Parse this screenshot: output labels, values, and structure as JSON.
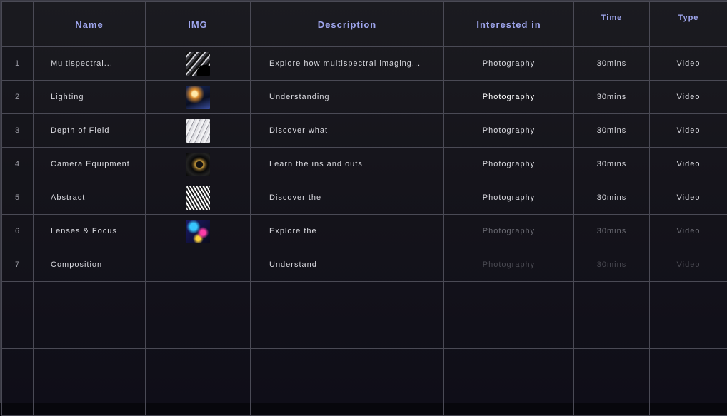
{
  "headers": {
    "name": "Name",
    "img": "IMG",
    "description": "Description",
    "interested": "Interested in",
    "time": "Time",
    "type": "Type"
  },
  "rows": [
    {
      "num": "1",
      "name": "Multispectral...",
      "image": "curved-metal-thumbnail",
      "description": "Explore how multispectral imaging...",
      "interested": "Photography",
      "time": "30mins",
      "type": "Video"
    },
    {
      "num": "2",
      "name": "Lighting",
      "image": "studio-light-thumbnail",
      "description": "Understanding",
      "interested": "Photography",
      "time": "30mins",
      "type": "Video"
    },
    {
      "num": "3",
      "name": "Depth of Field",
      "image": "white-waves-thumbnail",
      "description": "Discover what",
      "interested": "Photography",
      "time": "30mins",
      "type": "Video"
    },
    {
      "num": "4",
      "name": "Camera Equipment",
      "image": "camera-lens-thumbnail",
      "description": "Learn the ins and outs",
      "interested": "Photography",
      "time": "30mins",
      "type": "Video"
    },
    {
      "num": "5",
      "name": "Abstract",
      "image": "abstract-spiral-thumbnail",
      "description": "Discover the",
      "interested": "Photography",
      "time": "30mins",
      "type": "Video"
    },
    {
      "num": "6",
      "name": "Lenses & Focus",
      "image": "colorful-abstract-thumbnail",
      "description": "Explore the",
      "interested": "Photography",
      "time": "30mins",
      "type": "Video"
    },
    {
      "num": "7",
      "name": "Composition",
      "image": "",
      "description": "Understand",
      "interested": "Photography",
      "time": "30mins",
      "type": "Video"
    }
  ],
  "colors": {
    "header_text": "#9fa6ee",
    "grid_line": "#4a4a55",
    "background_top": "#1b1b20",
    "background_bottom": "#0f0e18"
  }
}
